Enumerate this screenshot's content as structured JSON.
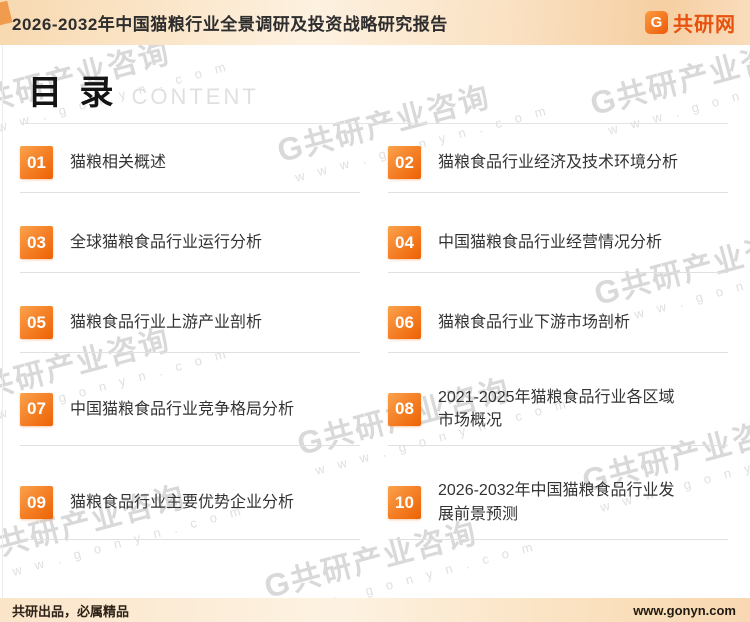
{
  "header": {
    "title": "2026-2032年中国猫粮行业全景调研及投资战略研究报告",
    "logo": {
      "icon": "G",
      "text": "共研网"
    }
  },
  "toc": {
    "title": "目 录",
    "subtitle": "CONTENT",
    "items": [
      {
        "num": "01",
        "label": "猫粮相关概述"
      },
      {
        "num": "02",
        "label": "猫粮食品行业经济及技术环境分析"
      },
      {
        "num": "03",
        "label": "全球猫粮食品行业运行分析"
      },
      {
        "num": "04",
        "label": "中国猫粮食品行业经营情况分析"
      },
      {
        "num": "05",
        "label": "猫粮食品行业上游产业剖析"
      },
      {
        "num": "06",
        "label": "猫粮食品行业下游市场剖析"
      },
      {
        "num": "07",
        "label": "中国猫粮食品行业竞争格局分析"
      },
      {
        "num": "08",
        "label": "2021-2025年猫粮食品行业各区域\n市场概况"
      },
      {
        "num": "09",
        "label": "猫粮食品行业主要优势企业分析"
      },
      {
        "num": "10",
        "label": "2026-2032年中国猫粮食品行业发\n展前景预测"
      }
    ]
  },
  "watermark": {
    "logo": "G",
    "brand": "共研产业咨询",
    "url": "w w w . g o n y n . c o m"
  },
  "footer": {
    "left": "共研出品，必属精品",
    "right": "www.gonyn.com"
  },
  "colors": {
    "accent": "#ee6204",
    "badge_gradient_start": "#faa24d",
    "badge_gradient_end": "#ee6204",
    "header_bg": "#f8d9b0",
    "underline": "#e0e0e0",
    "watermark_gray": "#d9d9d9"
  }
}
